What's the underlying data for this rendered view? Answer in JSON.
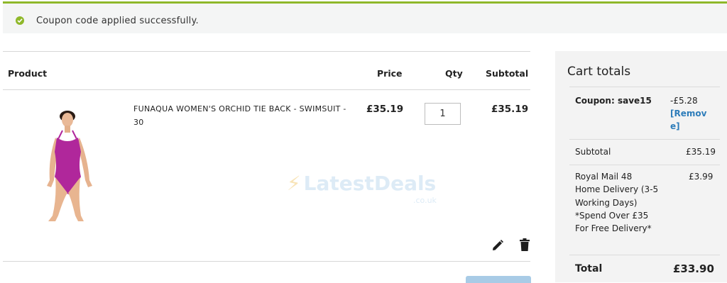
{
  "notice": {
    "message": "Coupon code applied successfully."
  },
  "cart": {
    "columns": {
      "product": "Product",
      "price": "Price",
      "qty": "Qty",
      "subtotal": "Subtotal"
    },
    "items": [
      {
        "name": "FUNAQUA WOMEN'S ORCHID TIE BACK - SWIMSUIT - 30",
        "price": "£35.19",
        "qty": "1",
        "subtotal": "£35.19"
      }
    ],
    "watermark": "LatestDeals",
    "watermark_sub": ".co.uk"
  },
  "totals": {
    "title": "Cart totals",
    "coupon_label": "Coupon: save15",
    "coupon_value": "-£5.28",
    "coupon_remove": "[Remove]",
    "subtotal_label": "Subtotal",
    "subtotal_value": "£35.19",
    "shipping_label": "Royal Mail 48 Home Delivery (3-5 Working Days) *Spend Over £35 For Free Delivery*",
    "shipping_value": "£3.99",
    "total_label": "Total",
    "total_value": "£33.90"
  },
  "colors": {
    "success": "#8fb82a",
    "link": "#2e7dba",
    "swimsuit": "#b0279b"
  },
  "icons": [
    "check-circle-icon",
    "pencil-icon",
    "trash-icon"
  ]
}
